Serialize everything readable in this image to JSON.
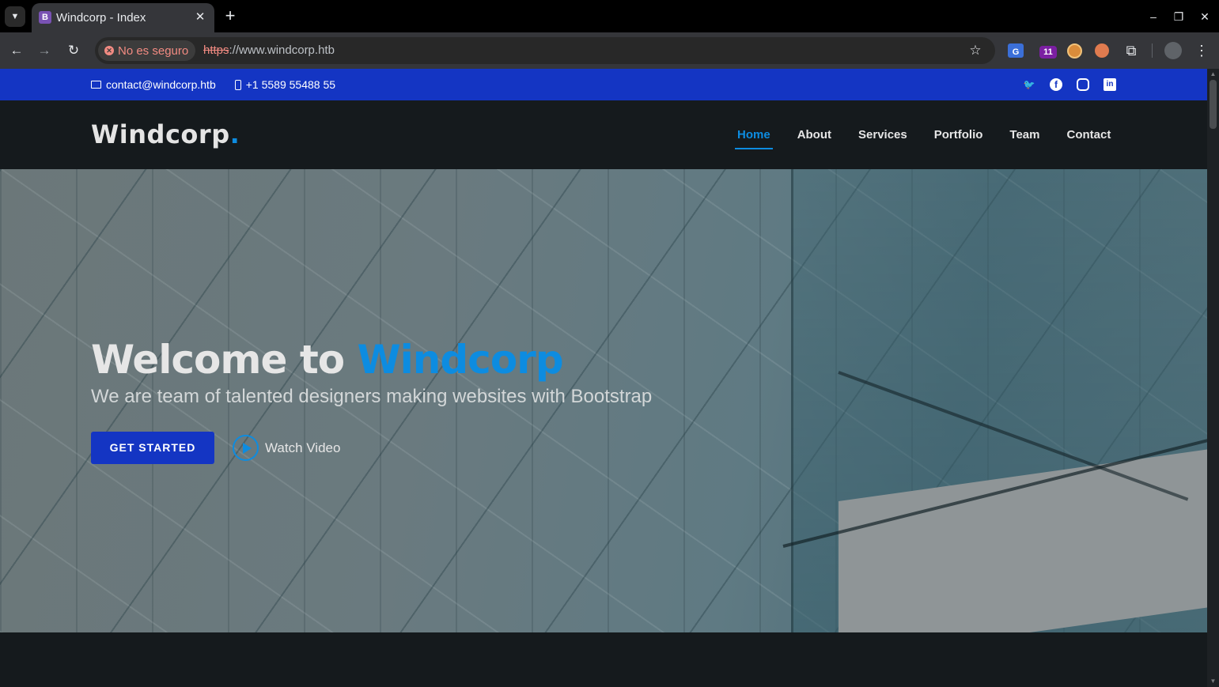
{
  "browser": {
    "tab": {
      "favicon_letter": "B",
      "title": "Windcorp - Index"
    },
    "security_label": "No es seguro",
    "url_scheme": "https",
    "url_rest": "://www.windcorp.htb",
    "extensions": {
      "translate_label": "G",
      "badge_count": "11"
    }
  },
  "topbar": {
    "email": "contact@windcorp.htb",
    "phone": "+1 5589 55488 55",
    "social": [
      "twitter-icon",
      "facebook-icon",
      "instagram-icon",
      "linkedin-icon"
    ]
  },
  "header": {
    "logo_text": "Windcorp",
    "logo_dot": ".",
    "nav": [
      {
        "label": "Home",
        "active": true
      },
      {
        "label": "About",
        "active": false
      },
      {
        "label": "Services",
        "active": false
      },
      {
        "label": "Portfolio",
        "active": false
      },
      {
        "label": "Team",
        "active": false
      },
      {
        "label": "Contact",
        "active": false
      }
    ]
  },
  "hero": {
    "title_prefix": "Welcome to ",
    "title_brand": "Windcorp",
    "subtitle": "We are team of talented designers making websites with Bootstrap",
    "cta_label": "GET STARTED",
    "video_label": "Watch Video"
  },
  "colors": {
    "topbar_bg": "#1435c3",
    "accent": "#0d8ce0",
    "header_bg": "#151a1d"
  }
}
